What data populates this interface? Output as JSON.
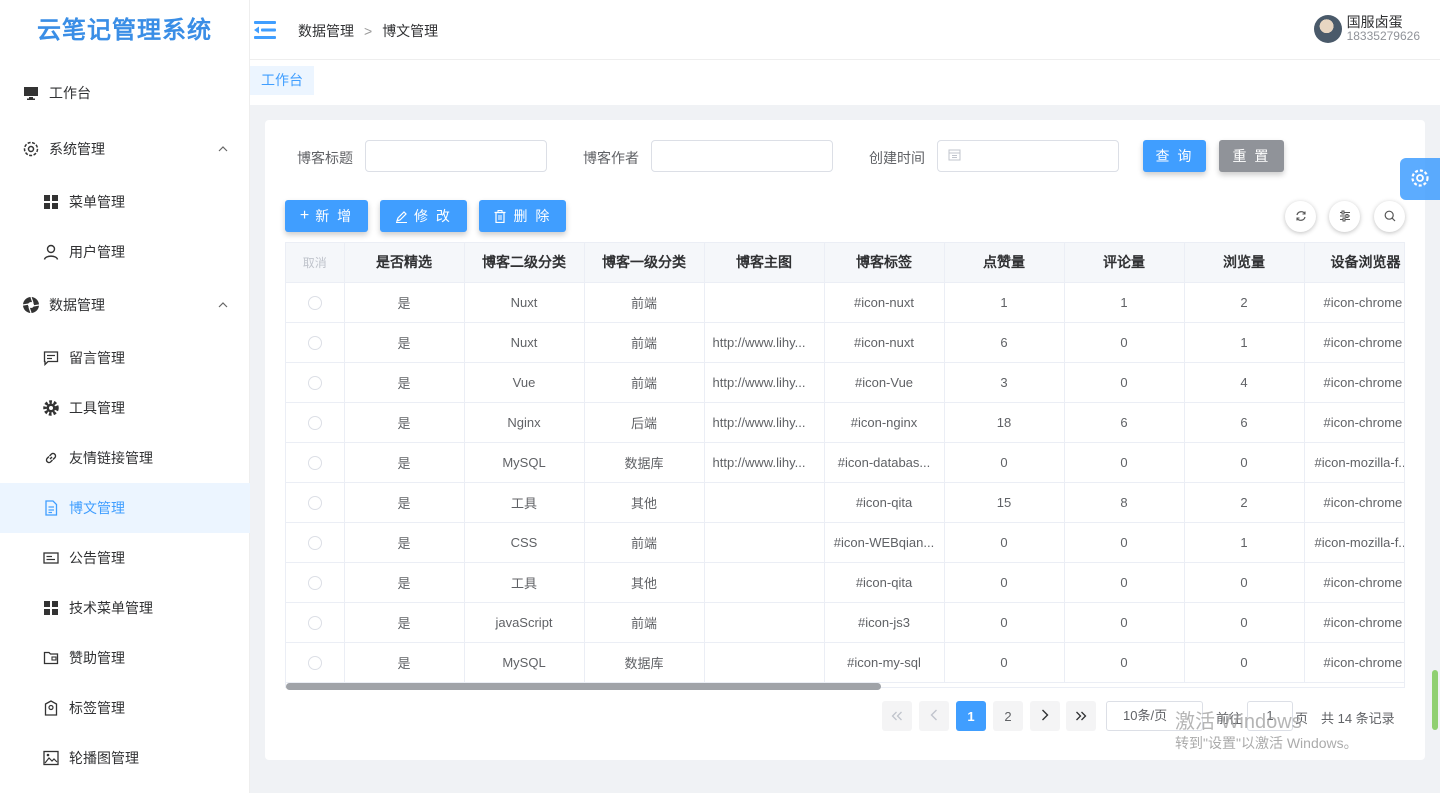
{
  "app": {
    "title": "云笔记管理系统"
  },
  "sidebar": {
    "items": [
      {
        "label": "工作台",
        "icon": "monitor-icon"
      },
      {
        "label": "系统管理",
        "icon": "gear-icon"
      },
      {
        "label": "菜单管理",
        "icon": "grid-icon"
      },
      {
        "label": "用户管理",
        "icon": "user-icon"
      },
      {
        "label": "数据管理",
        "icon": "aperture-icon"
      },
      {
        "label": "留言管理",
        "icon": "message-icon"
      },
      {
        "label": "工具管理",
        "icon": "cog-icon"
      },
      {
        "label": "友情链接管理",
        "icon": "link-icon"
      },
      {
        "label": "博文管理",
        "icon": "document-icon"
      },
      {
        "label": "公告管理",
        "icon": "notice-icon"
      },
      {
        "label": "技术菜单管理",
        "icon": "grid-icon"
      },
      {
        "label": "赞助管理",
        "icon": "folder-icon"
      },
      {
        "label": "标签管理",
        "icon": "tag-icon"
      },
      {
        "label": "轮播图管理",
        "icon": "picture-icon"
      }
    ]
  },
  "header": {
    "breadcrumb": [
      "数据管理",
      "博文管理"
    ],
    "user": {
      "name": "国服卤蛋",
      "phone": "18335279626"
    }
  },
  "tags": [
    "工作台"
  ],
  "filters": {
    "title_label": "博客标题",
    "author_label": "博客作者",
    "time_label": "创建时间",
    "search_button": "查 询",
    "reset_button": "重 置"
  },
  "toolbar": {
    "add": "新 增",
    "edit": "修 改",
    "delete": "删 除"
  },
  "table": {
    "columns": [
      "取消",
      "是否精选",
      "博客二级分类",
      "博客一级分类",
      "博客主图",
      "博客标签",
      "点赞量",
      "评论量",
      "浏览量",
      "设备浏览器"
    ],
    "rows": [
      [
        "是",
        "Nuxt",
        "前端",
        "",
        "#icon-nuxt",
        "1",
        "1",
        "2",
        "#icon-chrome"
      ],
      [
        "是",
        "Nuxt",
        "前端",
        "http://www.lihy...",
        "#icon-nuxt",
        "6",
        "0",
        "1",
        "#icon-chrome"
      ],
      [
        "是",
        "Vue",
        "前端",
        "http://www.lihy...",
        "#icon-Vue",
        "3",
        "0",
        "4",
        "#icon-chrome"
      ],
      [
        "是",
        "Nginx",
        "后端",
        "http://www.lihy...",
        "#icon-nginx",
        "18",
        "6",
        "6",
        "#icon-chrome"
      ],
      [
        "是",
        "MySQL",
        "数据库",
        "http://www.lihy...",
        "#icon-databas...",
        "0",
        "0",
        "0",
        "#icon-mozilla-f..."
      ],
      [
        "是",
        "工具",
        "其他",
        "",
        "#icon-qita",
        "15",
        "8",
        "2",
        "#icon-chrome"
      ],
      [
        "是",
        "CSS",
        "前端",
        "",
        "#icon-WEBqian...",
        "0",
        "0",
        "1",
        "#icon-mozilla-f..."
      ],
      [
        "是",
        "工具",
        "其他",
        "",
        "#icon-qita",
        "0",
        "0",
        "0",
        "#icon-chrome"
      ],
      [
        "是",
        "javaScript",
        "前端",
        "",
        "#icon-js3",
        "0",
        "0",
        "0",
        "#icon-chrome"
      ],
      [
        "是",
        "MySQL",
        "数据库",
        "",
        "#icon-my-sql",
        "0",
        "0",
        "0",
        "#icon-chrome"
      ]
    ]
  },
  "pagination": {
    "pages": [
      "1",
      "2"
    ],
    "current": "1",
    "page_size": "10条/页",
    "goto_label": "前往",
    "goto_value": "1",
    "page_suffix": "页",
    "total": "共 14 条记录"
  },
  "watermark": {
    "line1": "激活 Windows",
    "line2": "转到\"设置\"以激活 Windows。"
  },
  "colors": {
    "primary": "#409eff",
    "gray_button": "#909399",
    "active_bg": "#ecf5ff"
  }
}
